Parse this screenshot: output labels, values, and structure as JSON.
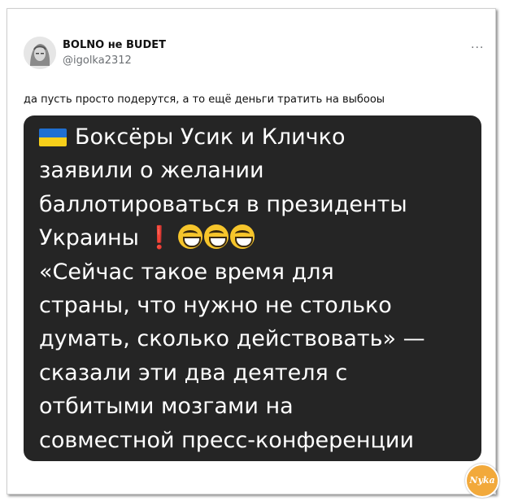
{
  "post": {
    "author_name": "BOLNO не BUDET",
    "author_handle": "@igolka2312",
    "more_icon": "more-horizontal-icon",
    "text": "да пусть просто подерутся, а то ещё деньги тратить на выбооы"
  },
  "card": {
    "flag_icon": "ukraine-flag-icon",
    "lines": [
      "Боксёры Усик и Кличко",
      "заявили о желании",
      "баллотироваться в президенты",
      "Украины",
      "«Сейчас такое время для",
      "страны, что нужно не столько",
      "думать, сколько действовать» —",
      "сказали эти два деятеля с",
      "отбитыми мозгами на",
      "совместной пресс-конференции"
    ],
    "exclamation": "❗",
    "emoji_icon": "grinning-face-emoji-icon"
  },
  "watermark": {
    "text": "Nyka"
  },
  "colors": {
    "card_background": "#252525",
    "card_text": "#ffffff",
    "handle_gray": "#6b6f73",
    "exclamation_red": "#e0262d",
    "watermark_orange": "#f2a93b"
  }
}
